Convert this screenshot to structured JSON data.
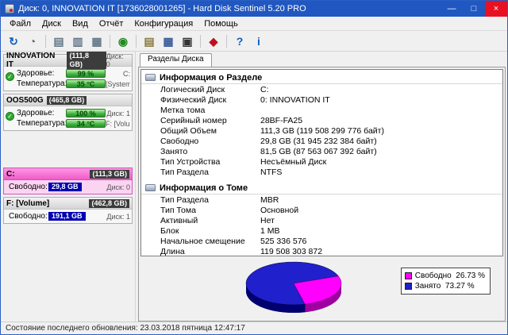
{
  "window": {
    "title": "Диск: 0, INNOVATION IT [1736028001265] - Hard Disk Sentinel 5.20 PRO",
    "controls": {
      "minimize": "—",
      "maximize": "□",
      "close": "×"
    },
    "status_bar": "Состояние последнего обновления: 23.03.2018 пятница 12:47:17"
  },
  "menu": {
    "items": [
      {
        "id": "file",
        "label": "Файл"
      },
      {
        "id": "disk",
        "label": "Диск"
      },
      {
        "id": "view",
        "label": "Вид"
      },
      {
        "id": "report",
        "label": "Отчёт"
      },
      {
        "id": "config",
        "label": "Конфигурация"
      },
      {
        "id": "help",
        "label": "Помощь"
      }
    ]
  },
  "toolbar": {
    "groups": [
      [
        {
          "name": "refresh-icon",
          "glyph": "↻",
          "color": "#1060c0"
        },
        {
          "name": "disk-clock-icon",
          "glyph": "◔",
          "color": "#5a6a7a"
        }
      ],
      [
        {
          "name": "disk-short-test-icon",
          "glyph": "▤",
          "color": "#667788"
        },
        {
          "name": "disk-extended-test-icon",
          "glyph": "▥",
          "color": "#667788"
        },
        {
          "name": "disk-surface-test-icon",
          "glyph": "▦",
          "color": "#667788"
        }
      ],
      [
        {
          "name": "globe-online-icon",
          "glyph": "◉",
          "color": "#1f8a1f"
        }
      ],
      [
        {
          "name": "report-icon",
          "glyph": "▤",
          "color": "#8a7a40"
        },
        {
          "name": "save-report-icon",
          "glyph": "▦",
          "color": "#3a5a9a"
        },
        {
          "name": "camera-icon",
          "glyph": "▣",
          "color": "#333333"
        }
      ],
      [
        {
          "name": "alert-monitor-icon",
          "glyph": "◆",
          "color": "#c01020"
        }
      ],
      [
        {
          "name": "help-icon",
          "glyph": "?",
          "color": "#1060c0"
        },
        {
          "name": "info-icon",
          "glyph": "i",
          "color": "#1060c0"
        }
      ]
    ]
  },
  "sidebar": {
    "disks": [
      {
        "name": "INNOVATION IT",
        "size": "(111,8 GB)",
        "header_right": "Диск: 0",
        "health_label": "Здоровье:",
        "health_value": "99 %",
        "health_right": "C:",
        "temp_label": "Температура:",
        "temp_value": "35 °C",
        "temp_right": "[System-res..."
      },
      {
        "name": "OOS500G",
        "size": "(465,8 GB)",
        "header_right": "",
        "health_label": "Здоровье:",
        "health_value": "100 %",
        "health_right": "Диск: 1",
        "temp_label": "Температура:",
        "temp_value": "34 °C",
        "temp_right": "F: [Volume]"
      }
    ],
    "partitions": [
      {
        "name": "C:",
        "size": "(111,3 GB)",
        "free_label": "Свободно:",
        "free_value": "29,8 GB",
        "disk_label": "Диск: 0",
        "selected": true
      },
      {
        "name": "F: [Volume]",
        "size": "(462,8 GB)",
        "free_label": "Свободно:",
        "free_value": "191,1 GB",
        "disk_label": "Диск: 1",
        "selected": false
      }
    ]
  },
  "main": {
    "tab_label": "Разделы Диска",
    "sections": [
      {
        "title": "Информация о Разделе",
        "rows": [
          [
            "Логический Диск",
            "C:"
          ],
          [
            "Физический Диск",
            "0: INNOVATION IT"
          ],
          [
            "Метка тома",
            ""
          ],
          [
            "Серийный номер",
            "28BF-FA25"
          ],
          [
            "Общий Объем",
            "111,3 GB (119 508 299 776 байт)"
          ],
          [
            "Свободно",
            "29,8 GB (31 945 232 384 байт)"
          ],
          [
            "Занято",
            "81,5 GB (87 563 067 392 байт)"
          ],
          [
            "Тип Устройства",
            "Несъёмный Диск"
          ],
          [
            "Тип Раздела",
            "NTFS"
          ]
        ]
      },
      {
        "title": "Информация о Томе",
        "rows": [
          [
            "Тип Раздела",
            "MBR"
          ],
          [
            "Тип Тома",
            "Основной"
          ],
          [
            "Активный",
            "Нет"
          ],
          [
            "Блок",
            "1 MB"
          ],
          [
            "Начальное смещение",
            "525 336 576"
          ],
          [
            "Длина",
            "119 508 303 872"
          ]
        ]
      }
    ]
  },
  "chart_data": {
    "type": "pie",
    "title": "",
    "labels": [
      "Свободно",
      "Занято"
    ],
    "values": [
      26.73,
      73.27
    ],
    "colors": [
      "#ff00ff",
      "#2020cc"
    ],
    "legend_position": "right",
    "legend": [
      {
        "label": "Свободно",
        "pct": "26.73 %"
      },
      {
        "label": "Занято",
        "pct": "73.27 %"
      }
    ]
  }
}
